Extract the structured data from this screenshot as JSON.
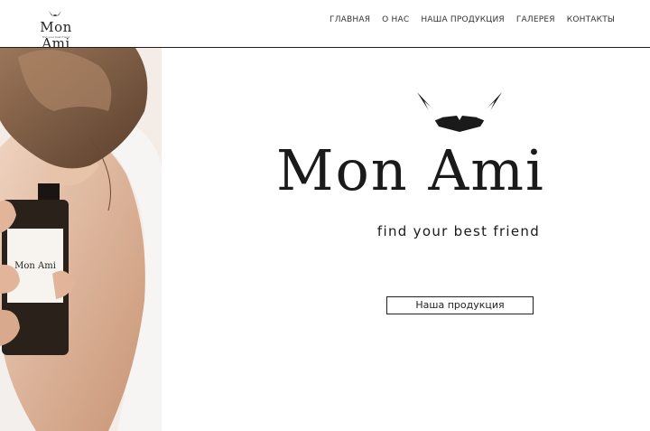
{
  "brand": {
    "name": "Mon Ami",
    "tagline": "find your best friend"
  },
  "nav": {
    "items": [
      {
        "label": "ГЛАВНАЯ"
      },
      {
        "label": "О НАС"
      },
      {
        "label": "НАША ПРОДУКЦИЯ"
      },
      {
        "label": "ГАЛЕРЕЯ"
      },
      {
        "label": "КОНТАКТЫ"
      }
    ]
  },
  "hero": {
    "title": "Mon Ami",
    "subtitle": "find your best friend",
    "cta_label": "Наша продукция"
  },
  "photo": {
    "bottle_label": "Mon Ami"
  },
  "colors": {
    "text": "#1a1a1a",
    "background": "#ffffff"
  }
}
